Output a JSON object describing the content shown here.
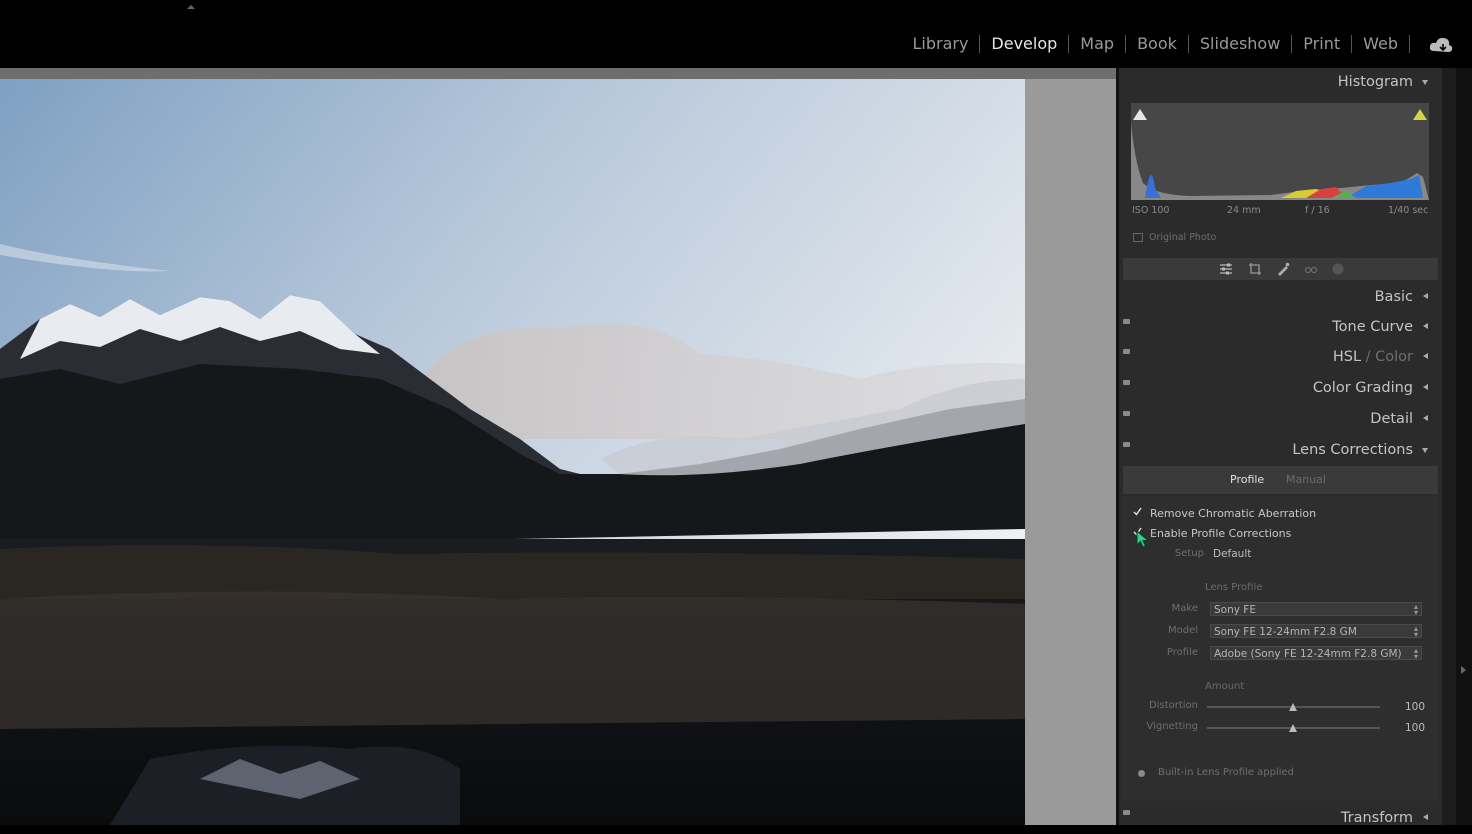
{
  "top_nav": {
    "modules": [
      {
        "label": "Library",
        "active": false
      },
      {
        "label": "Develop",
        "active": true
      },
      {
        "label": "Map",
        "active": false
      },
      {
        "label": "Book",
        "active": false
      },
      {
        "label": "Slideshow",
        "active": false
      },
      {
        "label": "Print",
        "active": false
      },
      {
        "label": "Web",
        "active": false
      }
    ],
    "sync_icon": "cloud-sync-icon"
  },
  "histogram": {
    "title": "Histogram",
    "iso": "ISO 100",
    "focal": "24 mm",
    "aperture": "f / 16",
    "shutter": "1/40 sec",
    "original_photo": "Original Photo"
  },
  "tool_icons": [
    "sliders-icon",
    "crop-icon",
    "brush-icon",
    "red-eye-icon",
    "mask-icon"
  ],
  "panels": {
    "basic": "Basic",
    "tone_curve": "Tone Curve",
    "hsl_a": "HSL",
    "hsl_sep": " / ",
    "hsl_b": "Color",
    "color_grading": "Color Grading",
    "detail": "Detail",
    "lens_corrections": "Lens Corrections",
    "transform": "Transform"
  },
  "lens": {
    "tab_profile": "Profile",
    "tab_manual": "Manual",
    "remove_ca": "Remove Chromatic Aberration",
    "enable_profile": "Enable Profile Corrections",
    "setup_label": "Setup",
    "setup_value": "Default",
    "lens_profile_heading": "Lens Profile",
    "make_label": "Make",
    "make_value": "Sony FE",
    "model_label": "Model",
    "model_value": "Sony FE 12-24mm F2.8 GM",
    "profile_label": "Profile",
    "profile_value": "Adobe (Sony FE 12-24mm F2.8 GM)",
    "amount_heading": "Amount",
    "distortion_label": "Distortion",
    "distortion_value": "100",
    "vignetting_label": "Vignetting",
    "vignetting_value": "100",
    "builtin_note": "Built-in Lens Profile applied"
  },
  "colors": {
    "accent": "#e6e6e6",
    "panel": "#2b2b2b",
    "cursor": "#2ecf8a"
  }
}
